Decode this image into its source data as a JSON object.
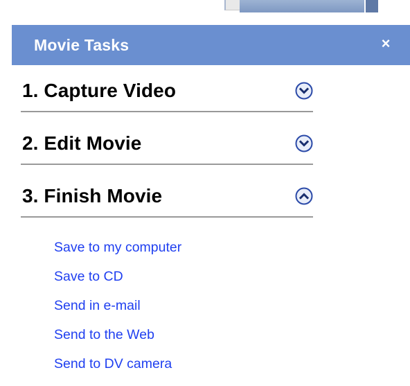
{
  "pane": {
    "title": "Movie Tasks",
    "close_label": "×"
  },
  "sections": [
    {
      "label": "1. Capture Video",
      "expanded": false,
      "icon": "chevron-down-icon"
    },
    {
      "label": "2. Edit Movie",
      "expanded": false,
      "icon": "chevron-down-icon"
    },
    {
      "label": "3. Finish Movie",
      "expanded": true,
      "icon": "chevron-up-icon"
    }
  ],
  "finish_links": [
    "Save to my computer",
    "Save to CD",
    "Send in e-mail",
    "Send to the Web",
    "Send to DV camera"
  ],
  "colors": {
    "header_bg": "#6a8fd0",
    "link": "#1f3ff0",
    "chevron_border": "#2b4aa8",
    "chevron_fill": "#e9eef9",
    "divider": "#999999"
  }
}
